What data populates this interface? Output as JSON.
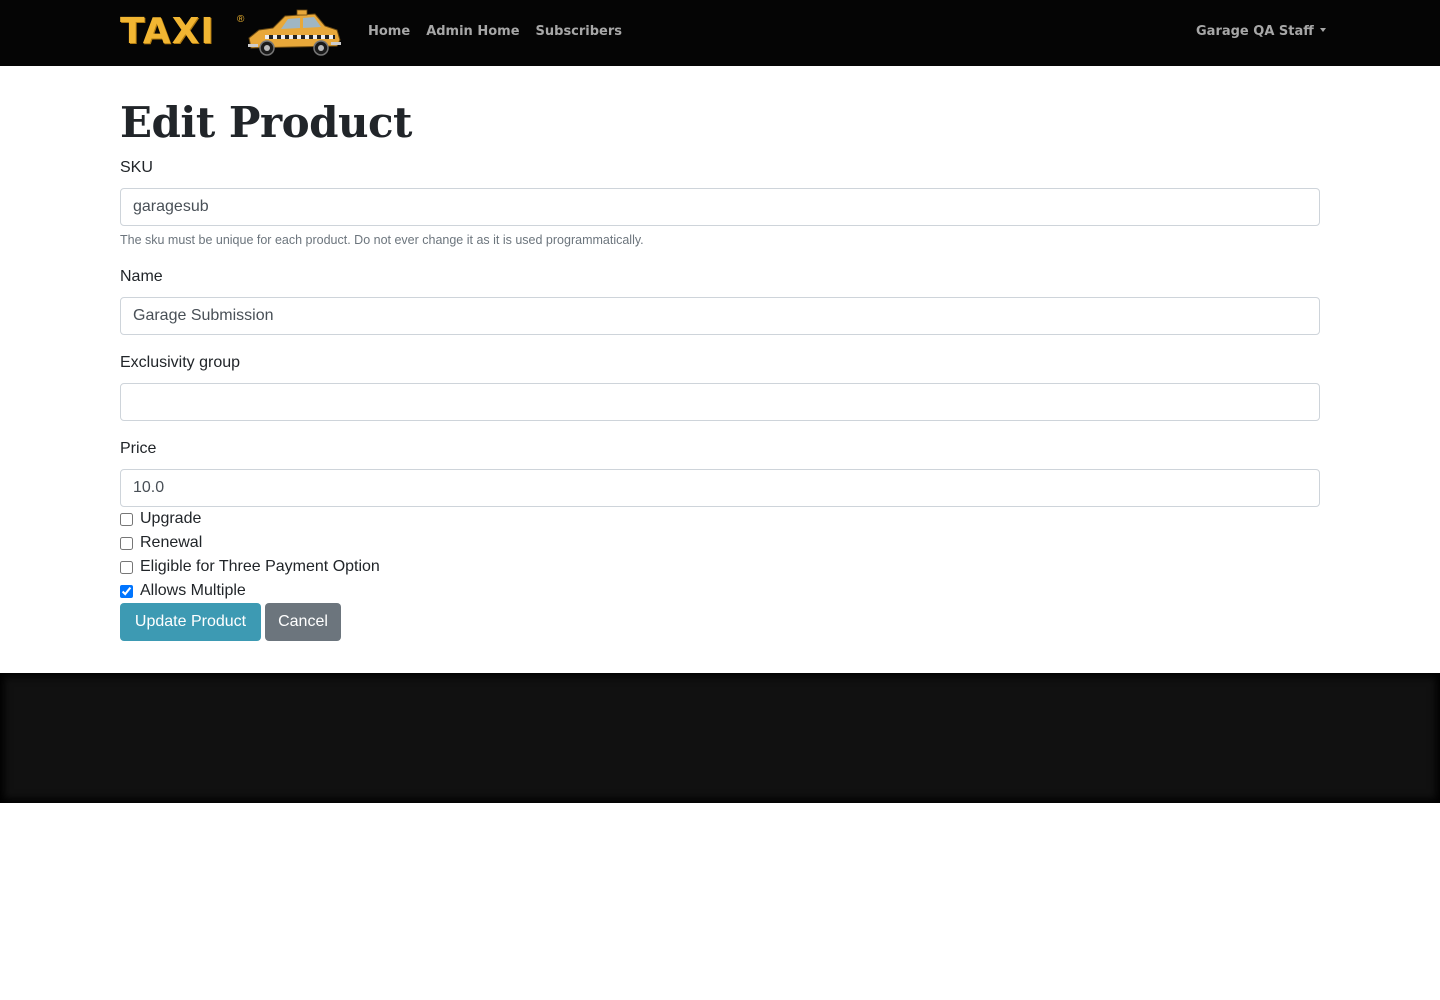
{
  "navbar": {
    "brand_text": "TAXI",
    "brand_mark": "®",
    "links": [
      {
        "label": "Home"
      },
      {
        "label": "Admin Home"
      },
      {
        "label": "Subscribers"
      }
    ],
    "user_menu": "Garage QA Staff",
    "background": "#050505",
    "brand_color": "#f2b632"
  },
  "page": {
    "title": "Edit Product"
  },
  "form": {
    "sku": {
      "label": "SKU",
      "value": "garagesub",
      "help": "The sku must be unique for each product. Do not ever change it as it is used programmatically."
    },
    "name": {
      "label": "Name",
      "value": "Garage Submission"
    },
    "exclusivity_group": {
      "label": "Exclusivity group",
      "value": ""
    },
    "price": {
      "label": "Price",
      "value": "10.0"
    },
    "checkboxes": [
      {
        "label": "Upgrade",
        "checked": false
      },
      {
        "label": "Renewal",
        "checked": false
      },
      {
        "label": "Eligible for Three Payment Option",
        "checked": false
      },
      {
        "label": "Allows Multiple",
        "checked": true
      }
    ],
    "submit_label": "Update Product",
    "cancel_label": "Cancel",
    "primary_color": "#3d9ab3",
    "secondary_color": "#6c757d"
  }
}
